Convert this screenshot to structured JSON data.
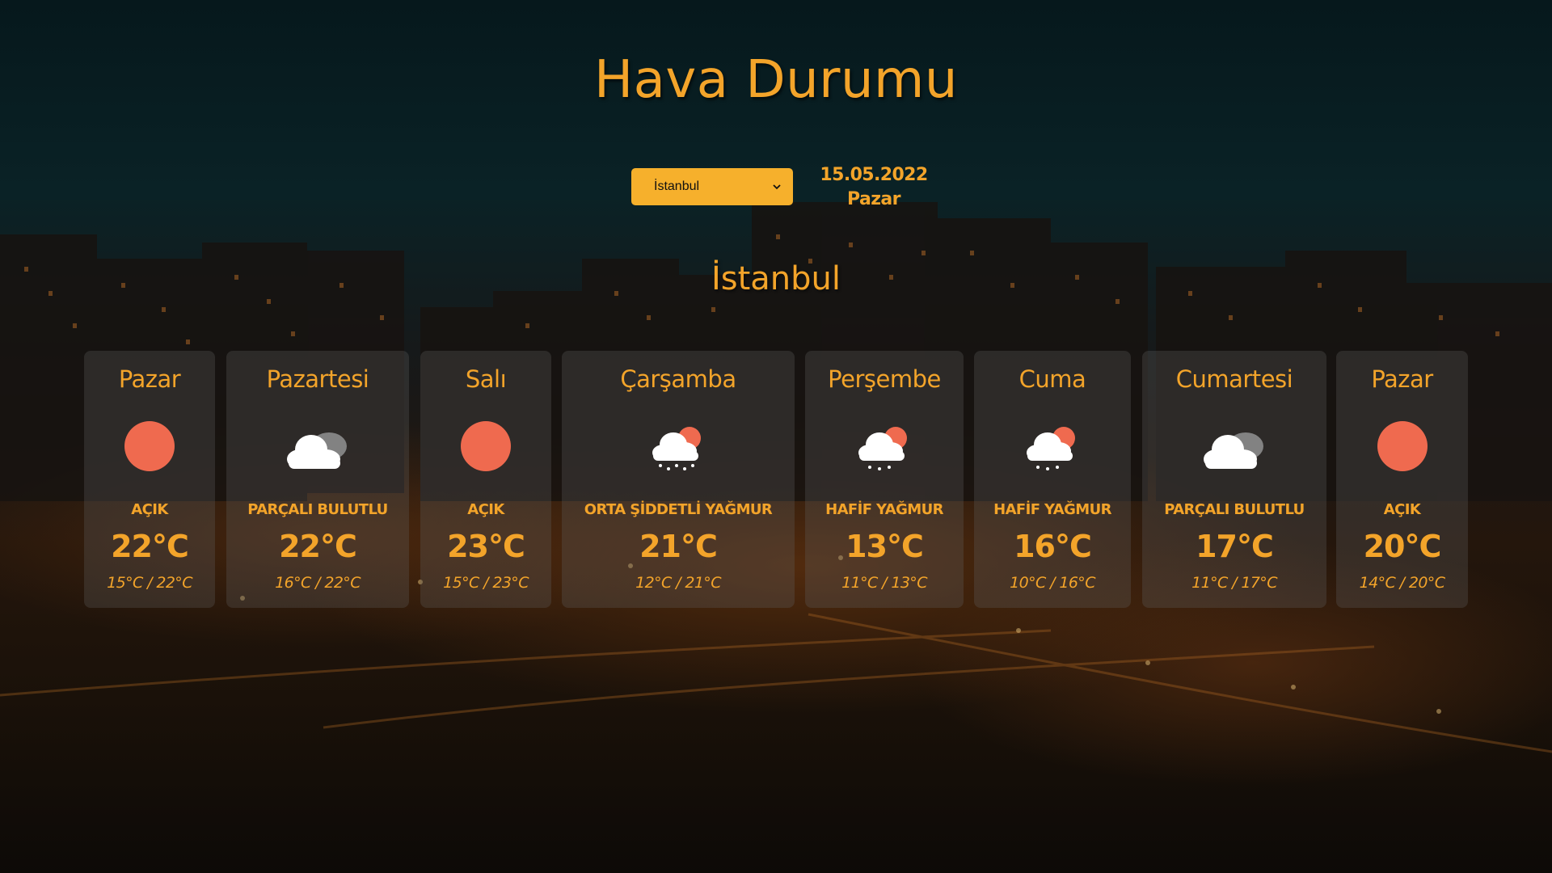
{
  "page": {
    "title": "Hava Durumu"
  },
  "controls": {
    "selected_city": "İstanbul",
    "date": "15.05.2022",
    "weekday": "Pazar"
  },
  "city": "İstanbul",
  "colors": {
    "accent": "#f3a42a",
    "select_bg": "#f6b02c",
    "sun": "#ef6a4f",
    "cloud": "#ffffff"
  },
  "forecast": [
    {
      "day": "Pazar",
      "icon": "sun-icon",
      "desc": "AÇIK",
      "temp": "22°C",
      "range": "15°C / 22°C"
    },
    {
      "day": "Pazartesi",
      "icon": "partly-cloudy-icon",
      "desc": "PARÇALI BULUTLU",
      "temp": "22°C",
      "range": "16°C / 22°C"
    },
    {
      "day": "Salı",
      "icon": "sun-icon",
      "desc": "AÇIK",
      "temp": "23°C",
      "range": "15°C / 23°C"
    },
    {
      "day": "Çarşamba",
      "icon": "rain-icon",
      "desc": "ORTA ŞİDDETLİ YAĞMUR",
      "temp": "21°C",
      "range": "12°C / 21°C"
    },
    {
      "day": "Perşembe",
      "icon": "rain-icon",
      "desc": "HAFİF YAĞMUR",
      "temp": "13°C",
      "range": "11°C / 13°C"
    },
    {
      "day": "Cuma",
      "icon": "rain-icon",
      "desc": "HAFİF YAĞMUR",
      "temp": "16°C",
      "range": "10°C / 16°C"
    },
    {
      "day": "Cumartesi",
      "icon": "partly-cloudy-icon",
      "desc": "PARÇALI BULUTLU",
      "temp": "17°C",
      "range": "11°C / 17°C"
    },
    {
      "day": "Pazar",
      "icon": "sun-icon",
      "desc": "AÇIK",
      "temp": "20°C",
      "range": "14°C / 20°C"
    }
  ]
}
